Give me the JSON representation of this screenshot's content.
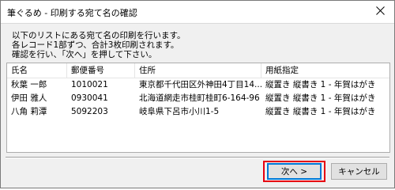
{
  "window": {
    "title": "筆ぐるめ - 印刷する宛て名の確認"
  },
  "instructions": [
    "以下のリストにある宛て名の印刷を行います。",
    "各レコード1部ずつ、合計3枚印刷されます。",
    "確認を行い、「次へ」を押して下さい。"
  ],
  "list": {
    "columns": [
      "氏名",
      "郵便番号",
      "住所",
      "用紙指定"
    ],
    "rows": [
      [
        "秋葉 一郎",
        "1010021",
        "東京都千代田区外神田4丁目14...",
        "縦置き 縦書き 1 - 年賀はがき"
      ],
      [
        "伊田 雅人",
        "0930041",
        "北海道網走市桂町桂町6-164-96",
        "縦置き 縦書き 1 - 年賀はがき"
      ],
      [
        "八角 莉潭",
        "5092203",
        "岐阜県下呂市小川1-5",
        "縦置き 縦書き 1 - 年賀はがき"
      ]
    ]
  },
  "buttons": {
    "next": "次へ >",
    "cancel": "キャンセル"
  },
  "colors": {
    "highlight": "#e60012",
    "focus": "#0078d7"
  },
  "icons": {
    "close": "close-icon"
  }
}
